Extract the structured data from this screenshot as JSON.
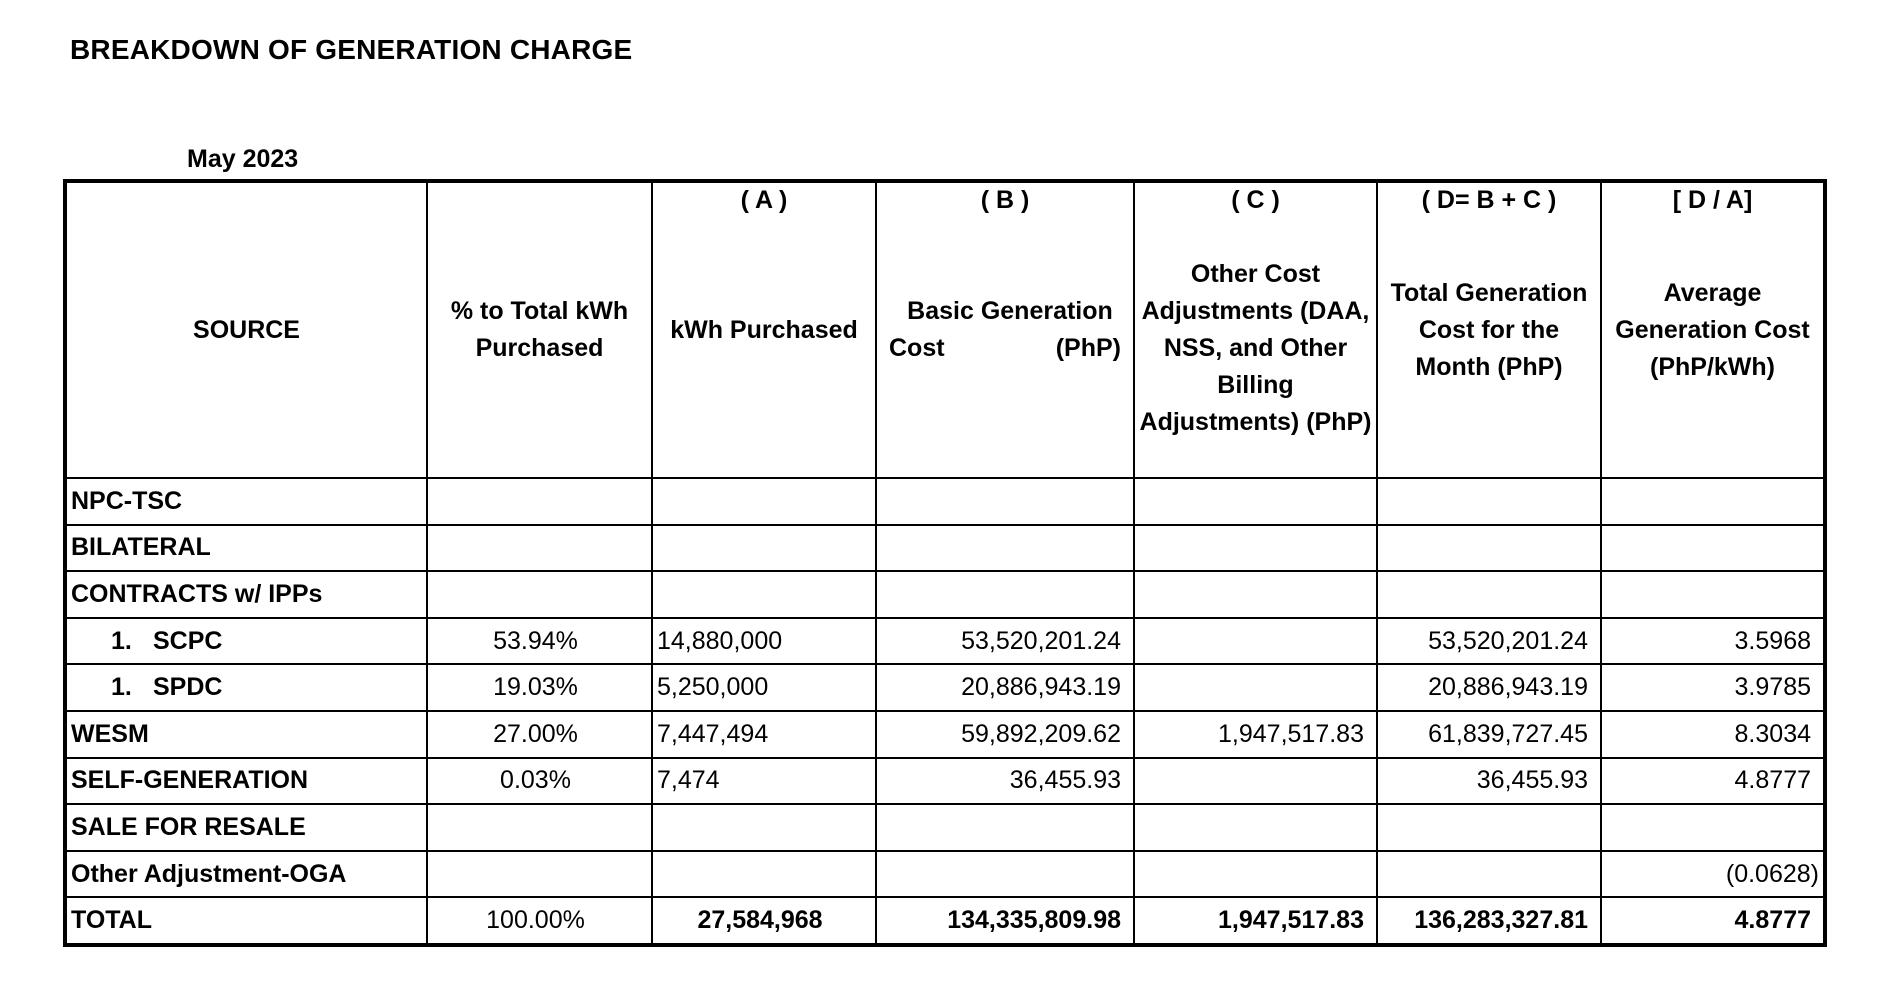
{
  "title": "BREAKDOWN OF GENERATION CHARGE",
  "period": "May 2023",
  "table": {
    "headers": {
      "source": "SOURCE",
      "pct": "% to Total kWh Purchased",
      "kwh_code": "( A )",
      "kwh": "kWh Purchased",
      "basic_code": "( B )",
      "basic_line1": "Basic Generation",
      "basic_line2a": "Cost",
      "basic_line2b": "(PhP)",
      "other_code": "( C )",
      "other": "Other Cost Adjustments (DAA, NSS, and Other Billing Adjustments) (PhP)",
      "total_code": "( D= B + C )",
      "total": "Total Generation Cost for the Month (PhP)",
      "avg_code": "[ D / A]",
      "avg": "Average Generation Cost (PhP/kWh)"
    },
    "rows": {
      "npc": {
        "source": "NPC-TSC",
        "pct": "",
        "kwh": "",
        "basic": "",
        "other": "",
        "total": "",
        "avg": ""
      },
      "bilateral_1": {
        "source": "BILATERAL"
      },
      "bilateral_2": {
        "source": "CONTRACTS w/ IPPs"
      },
      "scpc": {
        "num": "1.",
        "source": "SCPC",
        "pct": "53.94%",
        "kwh": "14,880,000",
        "basic": "53,520,201.24",
        "other": "",
        "total": "53,520,201.24",
        "avg": "3.5968"
      },
      "spdc": {
        "num": "1.",
        "source": "SPDC",
        "pct": "19.03%",
        "kwh": "5,250,000",
        "basic": "20,886,943.19",
        "other": "",
        "total": "20,886,943.19",
        "avg": "3.9785"
      },
      "wesm": {
        "source": "WESM",
        "pct": "27.00%",
        "kwh": "7,447,494",
        "basic": "59,892,209.62",
        "other": "1,947,517.83",
        "total": "61,839,727.45",
        "avg": "8.3034"
      },
      "selfgen": {
        "source": "SELF-GENERATION",
        "pct": "0.03%",
        "kwh": "7,474",
        "basic": "36,455.93",
        "other": "",
        "total": "36,455.93",
        "avg": "4.8777"
      },
      "resale": {
        "source": "SALE FOR RESALE",
        "pct": "",
        "kwh": "",
        "basic": "",
        "other": "",
        "total": "",
        "avg": ""
      },
      "oga": {
        "source": "Other Adjustment-OGA",
        "pct": "",
        "kwh": "",
        "basic": "",
        "other": "",
        "total": "",
        "avg": "(0.0628)"
      },
      "total": {
        "source": "TOTAL",
        "pct": "100.00%",
        "kwh": "27,584,968",
        "basic": "134,335,809.98",
        "other": "1,947,517.83",
        "total": "136,283,327.81",
        "avg": "4.8777"
      }
    }
  }
}
